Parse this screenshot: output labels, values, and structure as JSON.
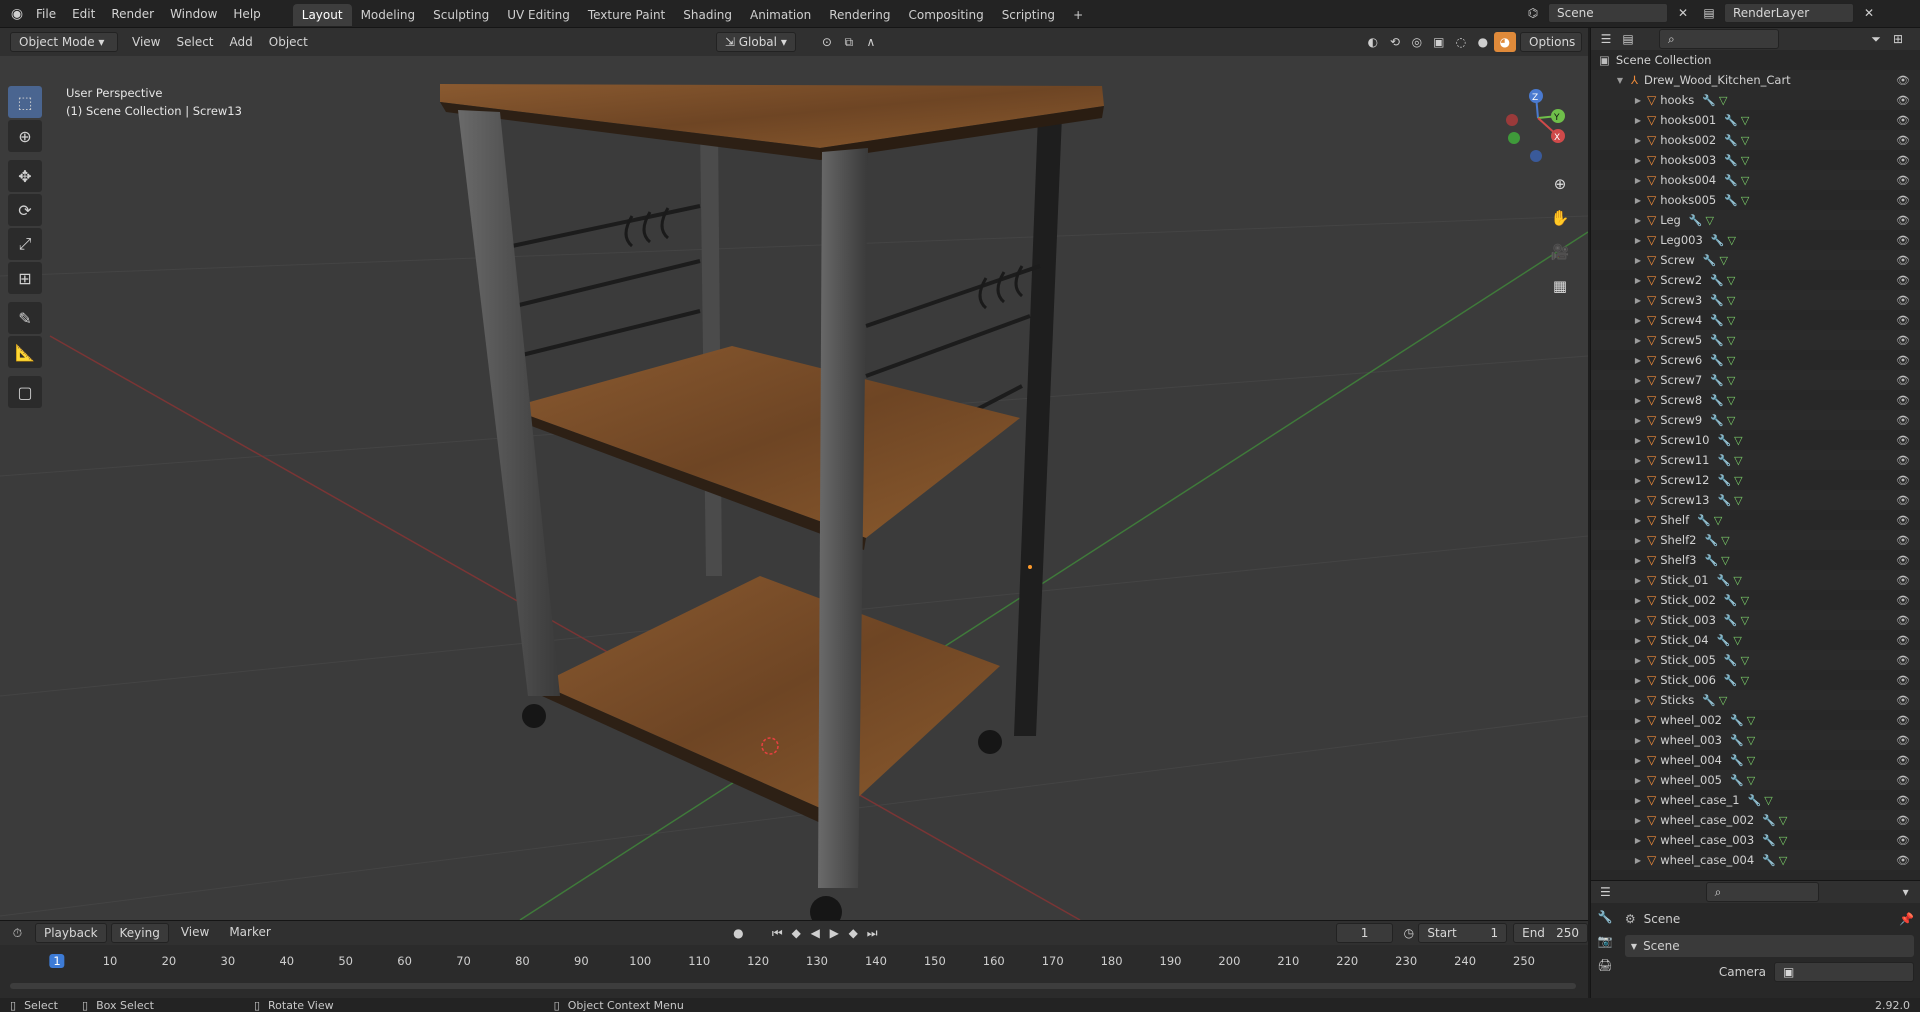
{
  "topbar": {
    "menus": [
      "File",
      "Edit",
      "Render",
      "Window",
      "Help"
    ],
    "workspaces": [
      "Layout",
      "Modeling",
      "Sculpting",
      "UV Editing",
      "Texture Paint",
      "Shading",
      "Animation",
      "Rendering",
      "Compositing",
      "Scripting"
    ],
    "active_workspace": "Layout",
    "add_tab": "+",
    "scene_name": "Scene",
    "render_layer": "RenderLayer"
  },
  "viewport_header": {
    "mode": "Object Mode",
    "menus": [
      "View",
      "Select",
      "Add",
      "Object"
    ],
    "orientation": "Global",
    "options": "Options"
  },
  "viewport": {
    "perspective_label": "User Perspective",
    "context_label": "(1) Scene Collection | Screw13",
    "axis_labels": [
      "Z",
      "Y",
      "X"
    ]
  },
  "outliner": {
    "search_placeholder": "",
    "root": "Scene Collection",
    "collection": "Drew_Wood_Kitchen_Cart",
    "objects": [
      "hooks",
      "hooks001",
      "hooks002",
      "hooks003",
      "hooks004",
      "hooks005",
      "Leg",
      "Leg003",
      "Screw",
      "Screw2",
      "Screw3",
      "Screw4",
      "Screw5",
      "Screw6",
      "Screw7",
      "Screw8",
      "Screw9",
      "Screw10",
      "Screw11",
      "Screw12",
      "Screw13",
      "Shelf",
      "Shelf2",
      "Shelf3",
      "Stick_01",
      "Stick_002",
      "Stick_003",
      "Stick_04",
      "Stick_005",
      "Stick_006",
      "Sticks",
      "wheel_002",
      "wheel_003",
      "wheel_004",
      "wheel_005",
      "wheel_case_1",
      "wheel_case_002",
      "wheel_case_003",
      "wheel_case_004"
    ]
  },
  "properties": {
    "scene_label": "Scene",
    "panel_title": "Scene",
    "camera_label": "Camera"
  },
  "timeline": {
    "menus": [
      "Playback",
      "Keying",
      "View",
      "Marker"
    ],
    "current_frame": "1",
    "start_label": "Start",
    "start_value": "1",
    "end_label": "End",
    "end_value": "250",
    "ruler": [
      "1",
      "10",
      "20",
      "30",
      "40",
      "50",
      "60",
      "70",
      "80",
      "90",
      "100",
      "110",
      "120",
      "130",
      "140",
      "150",
      "160",
      "170",
      "180",
      "190",
      "200",
      "210",
      "220",
      "230",
      "240",
      "250"
    ]
  },
  "statusbar": {
    "select": "Select",
    "box_select": "Box Select",
    "rotate_view": "Rotate View",
    "context_menu": "Object Context Menu",
    "version": "2.92.0"
  }
}
